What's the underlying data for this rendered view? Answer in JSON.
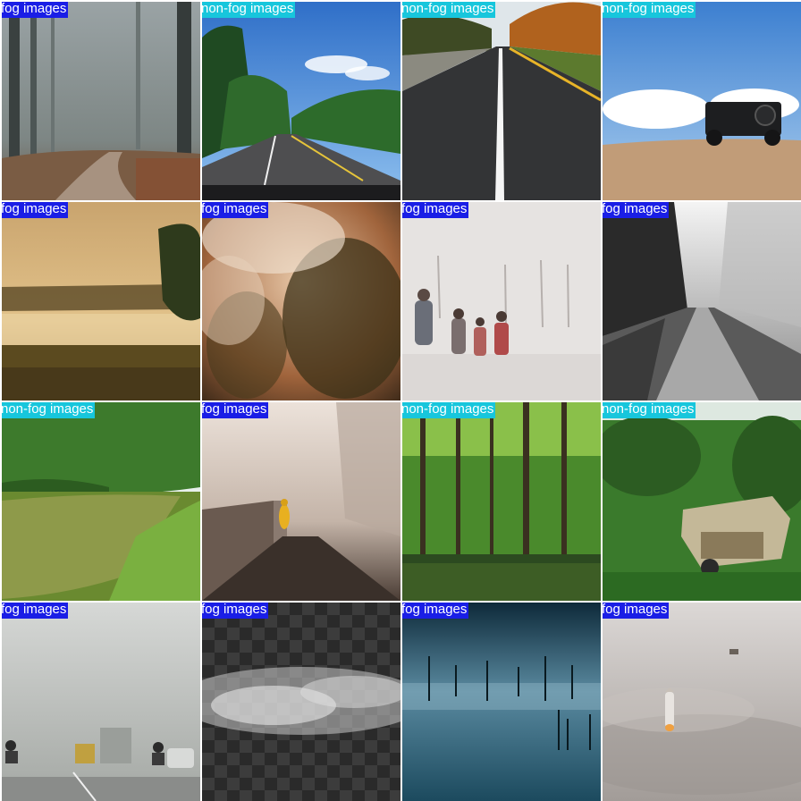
{
  "tile_class_colors": {
    "fog": "#1a1ee6",
    "non-fog": "#17c6dc"
  },
  "tiles": [
    {
      "label": "fog images",
      "class": "fog",
      "scene": "misty-forest-path"
    },
    {
      "label": "non-fog images",
      "class": "non-fog",
      "scene": "tropical-road"
    },
    {
      "label": "non-fog images",
      "class": "non-fog",
      "scene": "straight-highway"
    },
    {
      "label": "non-fog images",
      "class": "non-fog",
      "scene": "jeep-on-hill"
    },
    {
      "label": "fog images",
      "class": "fog",
      "scene": "misty-field-sunrise"
    },
    {
      "label": "fog images",
      "class": "fog",
      "scene": "foggy-forest-aerial"
    },
    {
      "label": "fog images",
      "class": "fog",
      "scene": "people-in-fog"
    },
    {
      "label": "fog images",
      "class": "fog",
      "scene": "foggy-dirt-road"
    },
    {
      "label": "non-fog images",
      "class": "non-fog",
      "scene": "green-river"
    },
    {
      "label": "fog images",
      "class": "fog",
      "scene": "person-in-foggy-street"
    },
    {
      "label": "non-fog images",
      "class": "non-fog",
      "scene": "flooded-forest"
    },
    {
      "label": "non-fog images",
      "class": "non-fog",
      "scene": "abandoned-jeep"
    },
    {
      "label": "fog images",
      "class": "fog",
      "scene": "smog-traffic"
    },
    {
      "label": "fog images",
      "class": "fog",
      "scene": "fog-overlay-transparent"
    },
    {
      "label": "fog images",
      "class": "fog",
      "scene": "misty-lake-dead-trees"
    },
    {
      "label": "fog images",
      "class": "fog",
      "scene": "rocket-launch-above-clouds"
    }
  ]
}
